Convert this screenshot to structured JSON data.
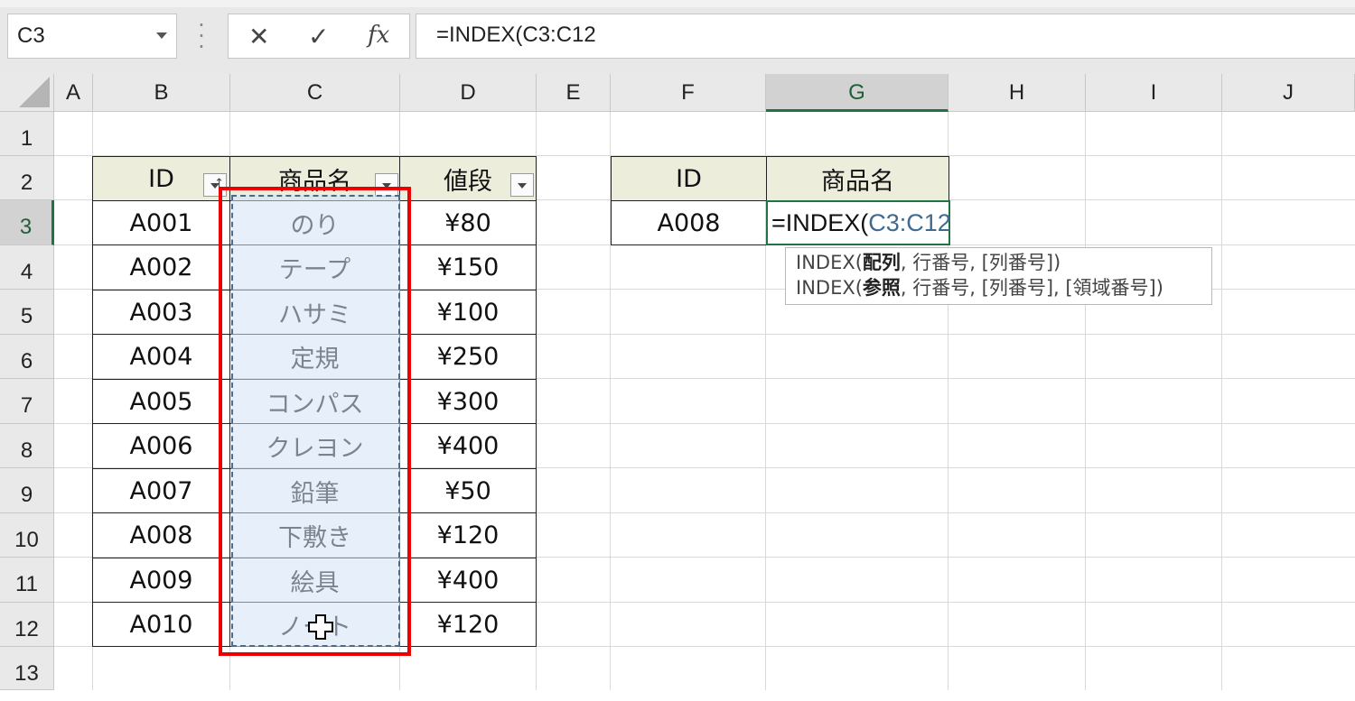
{
  "namebox": {
    "value": "C3"
  },
  "formula_bar": {
    "cancel_icon": "✕",
    "enter_icon": "✓",
    "fx_label": "fx",
    "formula": "=INDEX(C3:C12"
  },
  "columns": [
    "A",
    "B",
    "C",
    "D",
    "E",
    "F",
    "G",
    "H",
    "I",
    "J"
  ],
  "rows": [
    "1",
    "2",
    "3",
    "4",
    "5",
    "6",
    "7",
    "8",
    "9",
    "10",
    "11",
    "12",
    "13"
  ],
  "products_table": {
    "headers": [
      "ID",
      "商品名",
      "値段"
    ],
    "rows": [
      [
        "A001",
        "のり",
        "¥80"
      ],
      [
        "A002",
        "テープ",
        "¥150"
      ],
      [
        "A003",
        "ハサミ",
        "¥100"
      ],
      [
        "A004",
        "定規",
        "¥250"
      ],
      [
        "A005",
        "コンパス",
        "¥300"
      ],
      [
        "A006",
        "クレヨン",
        "¥400"
      ],
      [
        "A007",
        "鉛筆",
        "¥50"
      ],
      [
        "A008",
        "下敷き",
        "¥120"
      ],
      [
        "A009",
        "絵具",
        "¥400"
      ],
      [
        "A010",
        "ノート",
        "¥120"
      ]
    ]
  },
  "lookup_table": {
    "headers": [
      "ID",
      "商品名"
    ],
    "id_value": "A008",
    "editing_prefix": "=INDEX(",
    "editing_ref": "C3:C12"
  },
  "tooltip": {
    "line1": {
      "fn": "INDEX(",
      "bold": "配列",
      "rest": ", 行番号, [列番号])"
    },
    "line2": {
      "fn": "INDEX(",
      "bold": "参照",
      "rest": ", 行番号, [列番号], [領域番号])"
    }
  },
  "colors": {
    "selection_green": "#217346",
    "highlight_red": "#ee0000",
    "header_fill": "#ededdc",
    "ref_blue": "#3f6a8e"
  }
}
